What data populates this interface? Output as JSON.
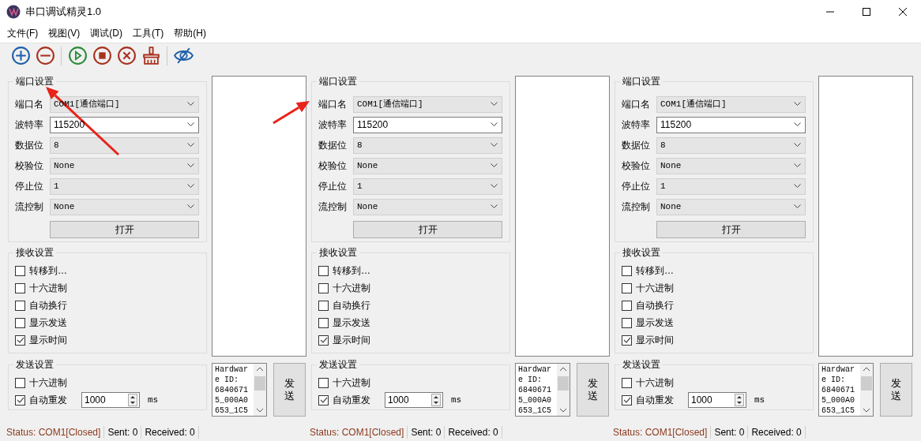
{
  "window": {
    "title": "串口调试精灵1.0"
  },
  "menu": [
    "文件(F)",
    "视图(V)",
    "调试(D)",
    "工具(T)",
    "帮助(H)"
  ],
  "toolbar": [
    {
      "kind": "add"
    },
    {
      "kind": "remove"
    },
    {
      "kind": "sep"
    },
    {
      "kind": "start"
    },
    {
      "kind": "stop"
    },
    {
      "kind": "cancel"
    },
    {
      "kind": "clear"
    },
    {
      "kind": "sep"
    },
    {
      "kind": "hide"
    }
  ],
  "panels": [
    {
      "port_settings": {
        "title": "端口设置",
        "fields": [
          {
            "label": "端口名",
            "value": "COM1[通信端口]",
            "kind": "dropdown"
          },
          {
            "label": "波特率",
            "value": "115200",
            "kind": "editable"
          },
          {
            "label": "数据位",
            "value": "8",
            "kind": "dropdown"
          },
          {
            "label": "校验位",
            "value": "None",
            "kind": "dropdown"
          },
          {
            "label": "停止位",
            "value": "1",
            "kind": "dropdown"
          },
          {
            "label": "流控制",
            "value": "None",
            "kind": "dropdown"
          }
        ],
        "open_button": "打开"
      },
      "receive_settings": {
        "title": "接收设置",
        "options": [
          {
            "label": "转移到…",
            "checked": false
          },
          {
            "label": "十六进制",
            "checked": false
          },
          {
            "label": "自动换行",
            "checked": false
          },
          {
            "label": "显示发送",
            "checked": false
          },
          {
            "label": "显示时间",
            "checked": true
          }
        ]
      },
      "send_settings": {
        "title": "发送设置",
        "options": [
          {
            "label": "十六进制",
            "checked": false
          },
          {
            "label": "自动重发",
            "checked": true
          }
        ],
        "interval": "1000",
        "unit": "ms"
      },
      "send_text": [
        "Hardwar",
        "e ID:",
        "6840671",
        "5_000A0",
        "653_1C5"
      ],
      "send_button": "发送",
      "status": {
        "status": "Status: COM1[Closed]",
        "sent": "Sent: 0",
        "received": "Received: 0"
      }
    },
    {
      "port_settings": {
        "title": "端口设置",
        "fields": [
          {
            "label": "端口名",
            "value": "COM1[通信端口]",
            "kind": "dropdown"
          },
          {
            "label": "波特率",
            "value": "115200",
            "kind": "editable"
          },
          {
            "label": "数据位",
            "value": "8",
            "kind": "dropdown"
          },
          {
            "label": "校验位",
            "value": "None",
            "kind": "dropdown"
          },
          {
            "label": "停止位",
            "value": "1",
            "kind": "dropdown"
          },
          {
            "label": "流控制",
            "value": "None",
            "kind": "dropdown"
          }
        ],
        "open_button": "打开"
      },
      "receive_settings": {
        "title": "接收设置",
        "options": [
          {
            "label": "转移到…",
            "checked": false
          },
          {
            "label": "十六进制",
            "checked": false
          },
          {
            "label": "自动换行",
            "checked": false
          },
          {
            "label": "显示发送",
            "checked": false
          },
          {
            "label": "显示时间",
            "checked": true
          }
        ]
      },
      "send_settings": {
        "title": "发送设置",
        "options": [
          {
            "label": "十六进制",
            "checked": false
          },
          {
            "label": "自动重发",
            "checked": true
          }
        ],
        "interval": "1000",
        "unit": "ms"
      },
      "send_text": [
        "Hardwar",
        "e ID:",
        "6840671",
        "5_000A0",
        "653_1C5"
      ],
      "send_button": "发送",
      "status": {
        "status": "Status: COM1[Closed]",
        "sent": "Sent: 0",
        "received": "Received: 0"
      }
    },
    {
      "port_settings": {
        "title": "端口设置",
        "fields": [
          {
            "label": "端口名",
            "value": "COM1[通信端口]",
            "kind": "dropdown"
          },
          {
            "label": "波特率",
            "value": "115200",
            "kind": "editable"
          },
          {
            "label": "数据位",
            "value": "8",
            "kind": "dropdown"
          },
          {
            "label": "校验位",
            "value": "None",
            "kind": "dropdown"
          },
          {
            "label": "停止位",
            "value": "1",
            "kind": "dropdown"
          },
          {
            "label": "流控制",
            "value": "None",
            "kind": "dropdown"
          }
        ],
        "open_button": "打开"
      },
      "receive_settings": {
        "title": "接收设置",
        "options": [
          {
            "label": "转移到…",
            "checked": false
          },
          {
            "label": "十六进制",
            "checked": false
          },
          {
            "label": "自动换行",
            "checked": false
          },
          {
            "label": "显示发送",
            "checked": false
          },
          {
            "label": "显示时间",
            "checked": true
          }
        ]
      },
      "send_settings": {
        "title": "发送设置",
        "options": [
          {
            "label": "十六进制",
            "checked": false
          },
          {
            "label": "自动重发",
            "checked": true
          }
        ],
        "interval": "1000",
        "unit": "ms"
      },
      "send_text": [
        "Hardwar",
        "e ID:",
        "6840671",
        "5_000A0",
        "653_1C5"
      ],
      "send_button": "发送",
      "status": {
        "status": "Status: COM1[Closed]",
        "sent": "Sent: 0",
        "received": "Received: 0"
      }
    }
  ],
  "annotations": [
    {
      "kind": "arrow"
    },
    {
      "kind": "arrow"
    }
  ]
}
